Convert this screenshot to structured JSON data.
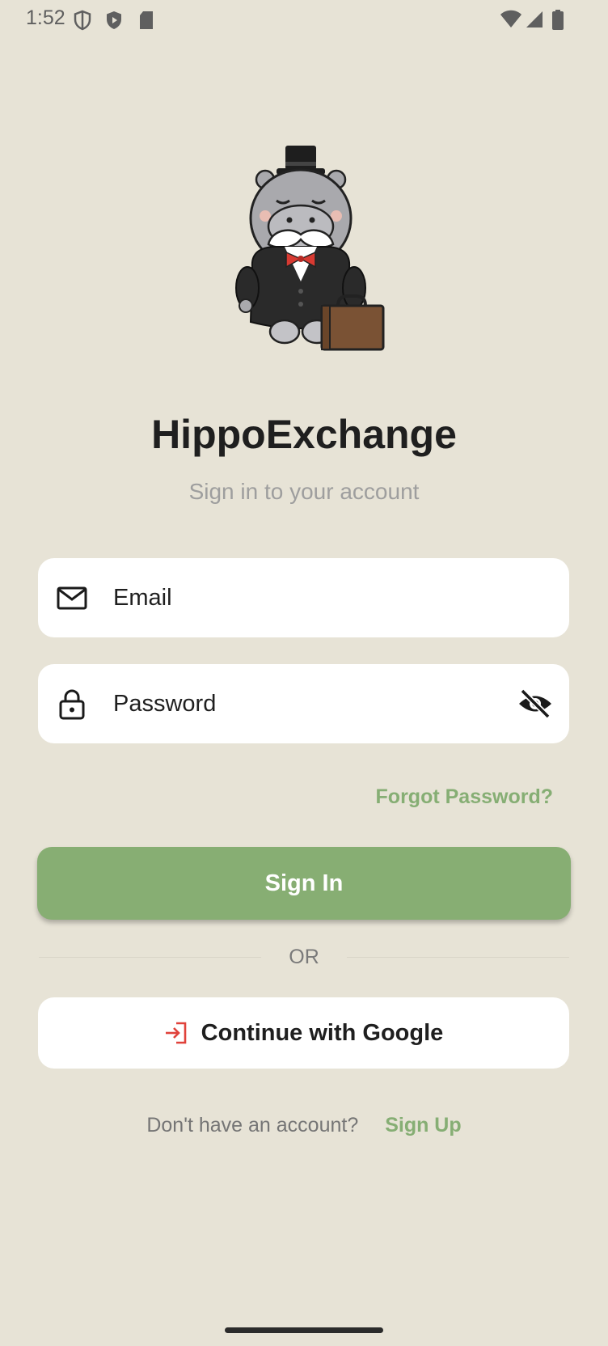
{
  "status_bar": {
    "time": "1:52",
    "left_icons": [
      "shield-outline-icon",
      "shield-play-icon",
      "sd-card-icon"
    ],
    "right_icons": [
      "wifi-icon",
      "cell-signal-icon",
      "battery-icon"
    ]
  },
  "app": {
    "title": "HippoExchange",
    "subtitle": "Sign in to your account",
    "logo": "hippo-mascot-logo"
  },
  "email_field": {
    "placeholder": "Email",
    "value": "",
    "icon": "mail-icon"
  },
  "password_field": {
    "placeholder": "Password",
    "value": "",
    "icon": "lock-icon",
    "toggle_icon": "eye-off-icon"
  },
  "forgot_password": "Forgot Password?",
  "sign_in_button": "Sign In",
  "divider_text": "OR",
  "google_button": {
    "label": "Continue with Google",
    "icon": "login-arrow-icon"
  },
  "signup": {
    "prompt": "Don't have an account?",
    "link": "Sign Up"
  },
  "colors": {
    "background": "#e7e3d6",
    "accent": "#87ae73",
    "text_dark": "#1f1f1f",
    "google_icon": "#e0423b"
  }
}
